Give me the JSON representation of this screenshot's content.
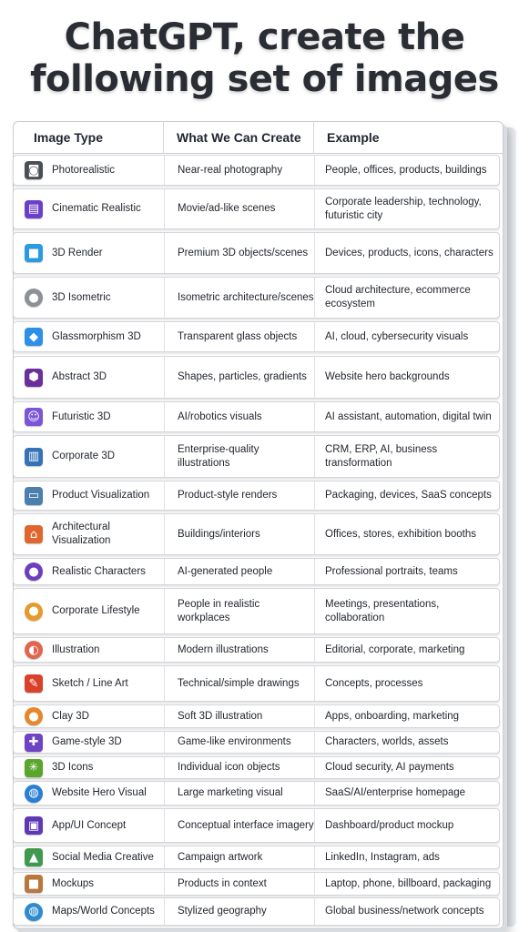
{
  "title": {
    "line1": "ChatGPT, create the",
    "line2": "following set of images"
  },
  "headers": {
    "type": "Image Type",
    "create": "What We Can Create",
    "example": "Example"
  },
  "rows": [
    {
      "type": "Photorealistic",
      "create": "Near-real photography",
      "example": "People, offices, products, buildings",
      "icon": "camera-icon",
      "color": "#4a4f57"
    },
    {
      "type": "Cinematic Realistic",
      "create": "Movie/ad-like scenes",
      "example": "Corporate leadership, technology, futuristic city",
      "icon": "clapperboard-icon",
      "color": "#6b3fc7"
    },
    {
      "type": "3D Render",
      "create": "Premium 3D objects/scenes",
      "example": "Devices, products, icons, characters",
      "icon": "cube-icon",
      "color": "#2a9be0"
    },
    {
      "type": "3D Isometric",
      "create": "Isometric architecture/scenes",
      "example": "Cloud architecture, ecommerce ecosystem",
      "icon": "sphere-icon",
      "color": "#8d9096"
    },
    {
      "type": "Glassmorphism 3D",
      "create": "Transparent glass objects",
      "example": "AI, cloud, cybersecurity visuals",
      "icon": "diamond-icon",
      "color": "#2e8fe8"
    },
    {
      "type": "Abstract 3D",
      "create": "Shapes, particles, gradients",
      "example": "Website hero backgrounds",
      "icon": "hexagon-icon",
      "color": "#6a2f9a"
    },
    {
      "type": "Futuristic 3D",
      "create": "AI/robotics visuals",
      "example": "AI assistant, automation, digital twin",
      "icon": "robot-icon",
      "color": "#7b56d6"
    },
    {
      "type": "Corporate 3D",
      "create": "Enterprise-quality illustrations",
      "example": "CRM, ERP, AI, business transformation",
      "icon": "building-icon",
      "color": "#3572b8"
    },
    {
      "type": "Product Visualization",
      "create": "Product-style renders",
      "example": "Packaging, devices, SaaS concepts",
      "icon": "monitor-icon",
      "color": "#4d7fae"
    },
    {
      "type": "Architectural Visualization",
      "create": "Buildings/interiors",
      "example": "Offices, stores, exhibition booths",
      "icon": "architecture-icon",
      "color": "#e0662e"
    },
    {
      "type": "Realistic Characters",
      "create": "AI-generated people",
      "example": "Professional portraits, teams",
      "icon": "person-icon",
      "color": "#6c3fbf"
    },
    {
      "type": "Corporate Lifestyle",
      "create": "People in realistic workplaces",
      "example": "Meetings, presentations, collaboration",
      "icon": "worker-icon",
      "color": "#e79a2a"
    },
    {
      "type": "Illustration",
      "create": "Modern illustrations",
      "example": "Editorial, corporate, marketing",
      "icon": "palette-icon",
      "color": "#e0664f"
    },
    {
      "type": "Sketch / Line Art",
      "create": "Technical/simple drawings",
      "example": "Concepts, processes",
      "icon": "pencil-icon",
      "color": "#d9412b"
    },
    {
      "type": "Clay 3D",
      "create": "Soft 3D illustration",
      "example": "Apps, onboarding, marketing",
      "icon": "clay-figure-icon",
      "color": "#e8862c"
    },
    {
      "type": "Game-style 3D",
      "create": "Game-like environments",
      "example": "Characters, worlds, assets",
      "icon": "gamepad-icon",
      "color": "#6e44c6"
    },
    {
      "type": "3D Icons",
      "create": "Individual icon objects",
      "example": "Cloud security, AI payments",
      "icon": "sparkle-icon",
      "color": "#5aa52c"
    },
    {
      "type": "Website Hero Visual",
      "create": "Large marketing visual",
      "example": "SaaS/AI/enterprise homepage",
      "icon": "globe-icon",
      "color": "#2a7fd4"
    },
    {
      "type": "App/UI Concept",
      "create": "Conceptual interface imagery",
      "example": "Dashboard/product mockup",
      "icon": "app-window-icon",
      "color": "#5d3ab4"
    },
    {
      "type": "Social Media Creative",
      "create": "Campaign artwork",
      "example": "LinkedIn, Instagram, ads",
      "icon": "landscape-image-icon",
      "color": "#3f9a4f"
    },
    {
      "type": "Mockups",
      "create": "Products in context",
      "example": "Laptop, phone, billboard, packaging",
      "icon": "box-icon",
      "color": "#b9773c"
    },
    {
      "type": "Maps/World Concepts",
      "create": "Stylized geography",
      "example": "Global business/network concepts",
      "icon": "earth-icon",
      "color": "#2d8bd0"
    }
  ]
}
